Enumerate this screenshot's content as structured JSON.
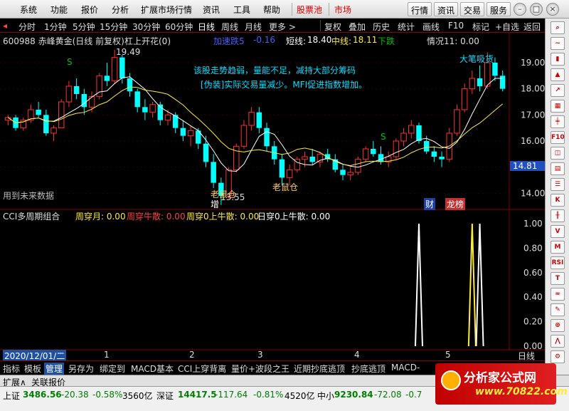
{
  "menu": {
    "items": [
      "系统",
      "功能",
      "报价",
      "分析",
      "扩展市场行情",
      "资讯",
      "工具",
      "帮助"
    ],
    "tabs": [
      "股票池",
      "市场"
    ],
    "right_buttons": [
      "行情",
      "资讯",
      "交易",
      "服务"
    ]
  },
  "timeframes": {
    "items": [
      "分时",
      "1分钟",
      "5分钟",
      "15分钟",
      "30分钟",
      "60分钟",
      "日线",
      "周线",
      "月线",
      "更多 >"
    ],
    "active": "日线",
    "right": [
      "复权",
      "叠加",
      "历史",
      "统计",
      "画线",
      "F10",
      "标记",
      "+自选",
      "返回"
    ]
  },
  "stock": {
    "title": "600988 赤峰黄金(日线 前复权)",
    "indicator": "杠上开花(0)",
    "accel": "加速跌5",
    "accel_value": "-0.16",
    "short_label": "短线:",
    "short_value": "18.40",
    "mid_label": "中线:",
    "mid_value": "18.11",
    "trend": "下跌",
    "situation": "情况11: 0.00"
  },
  "annotations": {
    "line1": "该股走势趋弱，量能不足，减持大部分筹码",
    "line2": "[伪装]实际交易量减少。MFI促进指数增加。",
    "high_price": "19.49",
    "low_price": "13.55",
    "future_data": "用到未来数据",
    "old_rat_1": "老鼠仓",
    "old_rat_2": "老鼠仓",
    "increase": "增",
    "buy_label": "大笔吸货",
    "signal_s": "S",
    "finance_badge": "财",
    "dragon_badge": "龙榜",
    "current_price": "14.81"
  },
  "price_axis": [
    "19.00",
    "18.00",
    "17.00",
    "16.00",
    "15.00",
    "14.00"
  ],
  "indicator_panel": {
    "title": "CCI多周期组合",
    "items": [
      {
        "label": "周穿月: 0.00",
        "color": "#ffeb3b"
      },
      {
        "label": "周穿牛散: 0.00",
        "color": "#ff4040"
      },
      {
        "label": "周穿0上牛散: 0.00",
        "color": "#ffeb3b"
      },
      {
        "label": "日穿0上牛散: 0.00",
        "color": "#ffffff"
      }
    ],
    "axis": [
      "1.00",
      "0.80",
      "0.60",
      "0.40",
      "0.20",
      "0.00"
    ]
  },
  "time_axis": {
    "date": "2020/12/01/二",
    "months": [
      "1",
      "2",
      "3",
      "4",
      "5"
    ],
    "period": "日线"
  },
  "bottom_tabs": [
    "指标",
    "模板",
    "管理",
    "另存为",
    "绑定到",
    "MACD基本",
    "CCI上穿背离",
    "量价+波段之王",
    "近期抄底逃顶",
    "抄底逃顶",
    "MACD-"
  ],
  "bottom_active": "管理",
  "expand_tabs": [
    "扩展∧",
    "关联报价"
  ],
  "status": {
    "sh_label": "上证",
    "sh_index": "3486.56",
    "sh_change": "-20.38",
    "sh_pct": "-0.58%",
    "sh_amount": "3560亿",
    "sz_label": "深证",
    "sz_index": "14417.5",
    "sz_change": "-117.64",
    "sz_pct": "-0.81%",
    "sz_amount": "4520亿",
    "zx_label": "中小",
    "zx_index": "9230.84",
    "zx_change": "-72.08",
    "zx_pct": "-0.7"
  },
  "brand": {
    "name": "分析家公式网",
    "url": "www.70822.com"
  },
  "colors": {
    "up": "#ff3030",
    "down": "#00ffff",
    "ma_white": "#ffffff",
    "ma_yellow": "#ffeb3b",
    "info_cyan": "#00e0ff",
    "accent_red": "#cc0000"
  },
  "chart_data": {
    "type": "candlestick",
    "x": [
      "2020-12",
      "2021-01",
      "2021-02",
      "2021-03",
      "2021-04",
      "2021-05"
    ],
    "ylim": [
      13.55,
      19.49
    ],
    "candles": [
      [
        16.8,
        17.0,
        16.6,
        16.9
      ],
      [
        16.9,
        17.0,
        16.4,
        16.5
      ],
      [
        16.5,
        16.9,
        16.4,
        16.8
      ],
      [
        16.8,
        17.4,
        16.7,
        17.2
      ],
      [
        17.2,
        17.5,
        16.9,
        17.0
      ],
      [
        17.0,
        17.2,
        16.2,
        16.3
      ],
      [
        16.3,
        16.6,
        16.0,
        16.5
      ],
      [
        16.5,
        17.6,
        16.5,
        17.5
      ],
      [
        17.5,
        18.3,
        17.3,
        18.1
      ],
      [
        18.1,
        18.4,
        17.6,
        17.8
      ],
      [
        17.8,
        18.0,
        17.0,
        17.3
      ],
      [
        17.3,
        17.9,
        17.1,
        17.7
      ],
      [
        17.7,
        18.6,
        17.6,
        18.5
      ],
      [
        18.5,
        19.0,
        18.1,
        18.3
      ],
      [
        18.3,
        19.49,
        18.2,
        19.2
      ],
      [
        19.2,
        19.3,
        18.2,
        18.4
      ],
      [
        18.4,
        18.6,
        17.7,
        17.9
      ],
      [
        17.9,
        18.0,
        17.1,
        17.3
      ],
      [
        17.3,
        17.6,
        16.8,
        17.1
      ],
      [
        17.1,
        17.5,
        16.9,
        17.4
      ],
      [
        17.4,
        17.5,
        16.6,
        16.8
      ],
      [
        16.8,
        17.2,
        16.6,
        17.0
      ],
      [
        17.0,
        17.1,
        16.3,
        16.5
      ],
      [
        16.5,
        16.8,
        16.0,
        16.2
      ],
      [
        16.2,
        16.6,
        15.8,
        16.4
      ],
      [
        16.4,
        16.5,
        15.7,
        15.9
      ],
      [
        15.9,
        16.2,
        15.0,
        15.2
      ],
      [
        15.2,
        15.5,
        14.2,
        14.4
      ],
      [
        14.4,
        14.6,
        13.55,
        13.9
      ],
      [
        13.9,
        15.0,
        13.8,
        14.9
      ],
      [
        14.9,
        15.9,
        14.8,
        15.8
      ],
      [
        15.8,
        16.8,
        15.7,
        16.6
      ],
      [
        16.6,
        17.3,
        16.4,
        17.1
      ],
      [
        17.1,
        17.3,
        16.3,
        16.5
      ],
      [
        16.5,
        16.7,
        15.6,
        15.8
      ],
      [
        15.8,
        16.0,
        15.1,
        15.3
      ],
      [
        15.3,
        15.5,
        14.3,
        14.6
      ],
      [
        14.6,
        15.1,
        14.3,
        14.9
      ],
      [
        14.9,
        15.4,
        14.8,
        15.3
      ],
      [
        15.3,
        15.6,
        15.0,
        15.4
      ],
      [
        15.4,
        15.7,
        15.1,
        15.2
      ],
      [
        15.2,
        15.6,
        15.0,
        15.5
      ],
      [
        15.5,
        15.7,
        15.2,
        15.3
      ],
      [
        15.3,
        15.5,
        14.8,
        14.9
      ],
      [
        14.9,
        15.1,
        14.5,
        14.7
      ],
      [
        14.7,
        15.0,
        14.5,
        14.8
      ],
      [
        14.8,
        15.4,
        14.7,
        15.3
      ],
      [
        15.3,
        15.8,
        15.2,
        15.7
      ],
      [
        15.7,
        16.0,
        15.4,
        15.5
      ],
      [
        15.5,
        15.8,
        15.1,
        15.2
      ],
      [
        15.2,
        15.6,
        15.0,
        15.4
      ],
      [
        15.4,
        16.1,
        15.3,
        16.0
      ],
      [
        16.0,
        16.5,
        15.8,
        16.3
      ],
      [
        16.3,
        16.8,
        16.1,
        16.6
      ],
      [
        16.6,
        16.7,
        15.9,
        16.0
      ],
      [
        16.0,
        16.2,
        15.5,
        15.6
      ],
      [
        15.6,
        15.8,
        15.2,
        15.4
      ],
      [
        15.4,
        15.6,
        15.0,
        15.3
      ],
      [
        15.3,
        16.5,
        15.2,
        16.3
      ],
      [
        16.3,
        17.4,
        16.2,
        17.2
      ],
      [
        17.2,
        18.2,
        17.1,
        18.0
      ],
      [
        18.0,
        18.7,
        17.8,
        18.4
      ],
      [
        18.4,
        18.9,
        17.9,
        18.1
      ],
      [
        18.1,
        19.4,
        18.0,
        19.0
      ],
      [
        19.0,
        19.2,
        18.3,
        18.5
      ],
      [
        18.5,
        18.7,
        17.9,
        18.0
      ]
    ],
    "indicator_spikes": [
      {
        "index": 54,
        "value": 1.0,
        "color": "#ffffff"
      },
      {
        "index": 61,
        "value": 1.0,
        "color": "#ffeb3b"
      },
      {
        "index": 62,
        "value": 1.0,
        "color": "#ffffff"
      }
    ]
  }
}
